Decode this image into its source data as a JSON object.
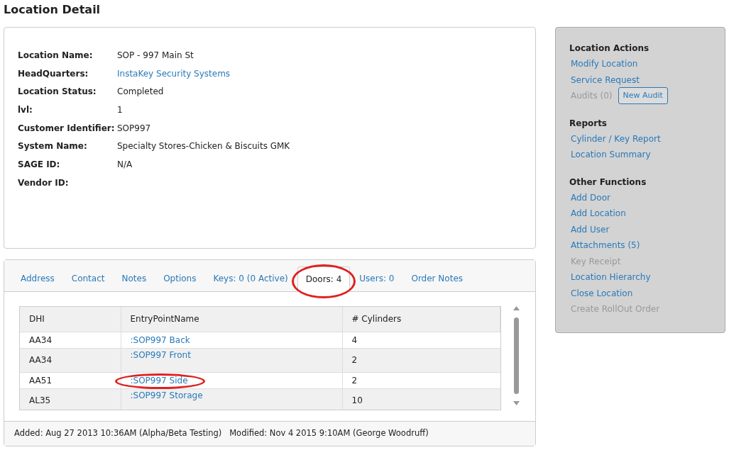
{
  "page_title": "Location Detail",
  "details": [
    {
      "label": "Location Name:",
      "value": "SOP - 997 Main St",
      "kind": "text"
    },
    {
      "label": "HeadQuarters:",
      "value": "InstaKey Security Systems",
      "kind": "link"
    },
    {
      "label": "Location Status:",
      "value": "Completed",
      "kind": "text"
    },
    {
      "label": "lvl:",
      "value": "1",
      "kind": "text"
    },
    {
      "label": "Customer Identifier:",
      "value": "SOP997",
      "kind": "text"
    },
    {
      "label": "System Name:",
      "value": "Specialty Stores-Chicken & Biscuits GMK",
      "kind": "text"
    },
    {
      "label": "SAGE ID:",
      "value": "N/A",
      "kind": "text"
    },
    {
      "label": "Vendor ID:"
    }
  ],
  "tabs": [
    {
      "label": "Address",
      "selected": false,
      "circled": false
    },
    {
      "label": "Contact",
      "selected": false,
      "circled": false
    },
    {
      "label": "Notes",
      "selected": false,
      "circled": false
    },
    {
      "label": "Options",
      "selected": false,
      "circled": false
    },
    {
      "label": "Keys: 0 (0 Active)",
      "selected": false,
      "circled": false
    },
    {
      "label": "Doors: 4",
      "selected": true,
      "circled": true
    },
    {
      "label": "Users: 0",
      "selected": false,
      "circled": false
    },
    {
      "label": "Order Notes",
      "selected": false,
      "circled": false
    }
  ],
  "table": {
    "columns": [
      "DHI",
      "EntryPointName",
      "# Cylinders"
    ],
    "rows": [
      {
        "dhi": "AA34",
        "entry": ":SOP997 Back",
        "cylinders": "4",
        "tall": false,
        "circled": false
      },
      {
        "dhi": "AA34",
        "entry": ":SOP997 Front",
        "cylinders": "2",
        "tall": true,
        "circled": false
      },
      {
        "dhi": "AA51",
        "entry": ":SOP997 Side",
        "cylinders": "2",
        "tall": false,
        "circled": true
      },
      {
        "dhi": "AL35",
        "entry": ":SOP997 Storage",
        "cylinders": "10",
        "tall": true,
        "circled": false
      }
    ]
  },
  "footer": "Added: Aug 27 2013 10:36AM (Alpha/Beta Testing)   Modified: Nov 4 2015 9:10AM (George Woodruff)",
  "sidebar": [
    {
      "heading": "Location Actions",
      "items": [
        {
          "label": "Modify Location",
          "disabled": false
        },
        {
          "label": "Service Request",
          "disabled": false
        },
        {
          "label": "Audits (0)",
          "disabled": true,
          "button": "New Audit"
        }
      ]
    },
    {
      "heading": "Reports",
      "items": [
        {
          "label": "Cylinder / Key Report",
          "disabled": false
        },
        {
          "label": "Location Summary",
          "disabled": false
        }
      ]
    },
    {
      "heading": "Other Functions",
      "items": [
        {
          "label": "Add Door",
          "disabled": false
        },
        {
          "label": "Add Location",
          "disabled": false
        },
        {
          "label": "Add User",
          "disabled": false
        },
        {
          "label": "Attachments (5)",
          "disabled": false
        },
        {
          "label": "Key Receipt",
          "disabled": true
        },
        {
          "label": "Location Hierarchy",
          "disabled": false
        },
        {
          "label": "Close Location",
          "disabled": false
        },
        {
          "label": "Create RollOut Order",
          "disabled": true
        }
      ]
    }
  ]
}
